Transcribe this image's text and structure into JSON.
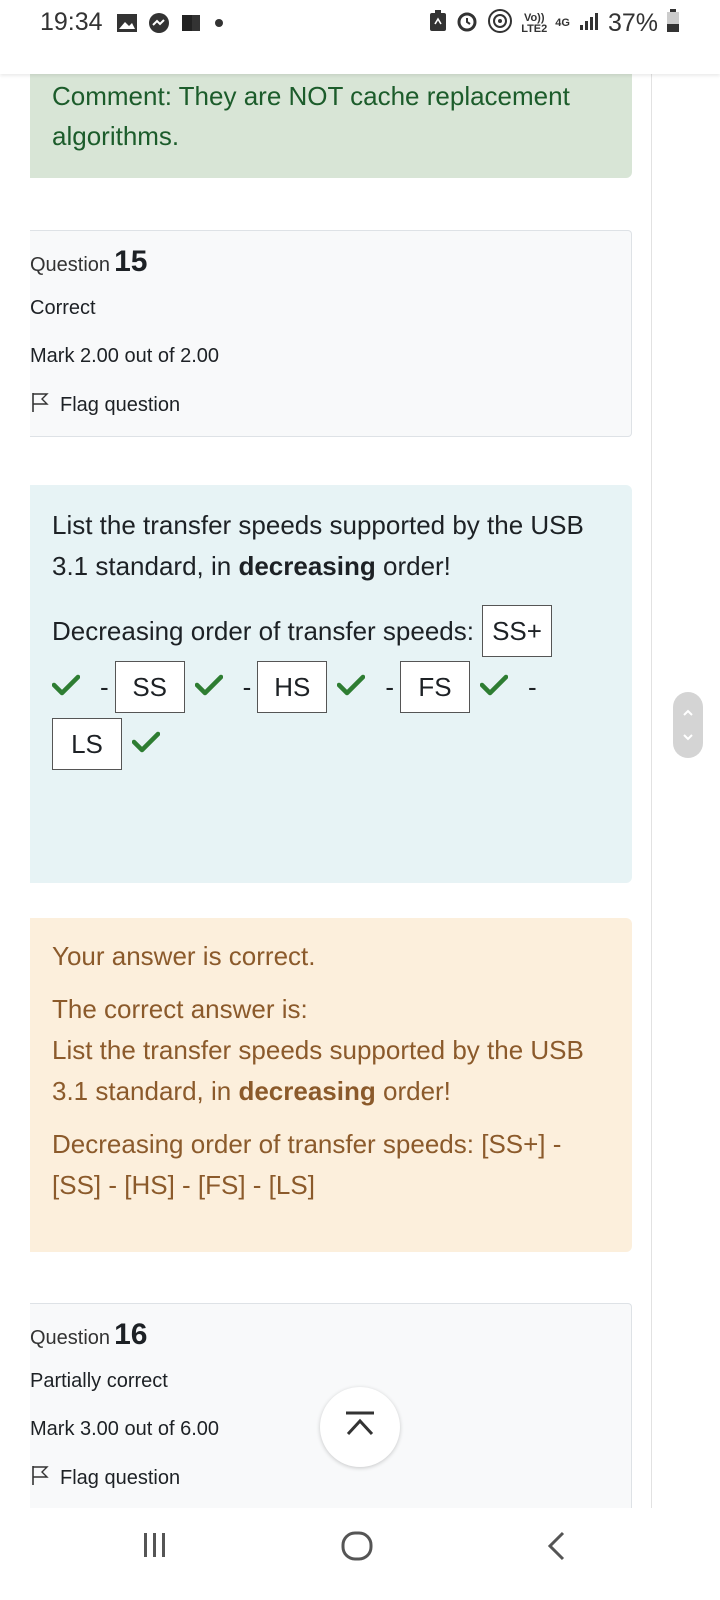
{
  "status_bar": {
    "time": "19:34",
    "battery_percent": "37%",
    "network_top": "Vo))",
    "network_bottom": "LTE2",
    "network_type": "4G",
    "icons": [
      "gallery-icon",
      "messenger-icon",
      "flipboard-icon",
      "dot-icon",
      "battery-saver-icon",
      "alarm-icon",
      "hotspot-icon",
      "signal-icon",
      "battery-icon"
    ]
  },
  "prev_comment": {
    "text": "Comment: They are NOT cache replacement algorithms."
  },
  "question15": {
    "label": "Question",
    "number": "15",
    "state": "Correct",
    "mark": "Mark 2.00 out of 2.00",
    "flag": "Flag question"
  },
  "formulation": {
    "prompt_pre": "List the transfer speeds supported by the USB 3.1 standard, in ",
    "prompt_bold": "decreasing",
    "prompt_post": " order!",
    "answer_label": "Decreasing order of transfer speeds:",
    "separator": "-",
    "answers": [
      "SS+",
      "SS",
      "HS",
      "FS",
      "LS"
    ],
    "answer_status": [
      "correct",
      "correct",
      "correct",
      "correct",
      "correct"
    ]
  },
  "feedback": {
    "result": "Your answer is correct.",
    "correct_intro": "The correct answer is:",
    "prompt_pre": "List the transfer speeds supported by the USB 3.1 standard, in ",
    "prompt_bold": "decreasing",
    "prompt_post": " order!",
    "answer_line": "Decreasing order of transfer speeds: [SS+] - [SS] - [HS] - [FS] - [LS]"
  },
  "question16": {
    "label": "Question",
    "number": "16",
    "state": "Partially correct",
    "mark": "Mark 3.00 out of 6.00",
    "flag": "Flag question"
  },
  "colors": {
    "correct_green": "#2e7d32",
    "comment_bg": "#d8e5d6",
    "formulation_bg": "#e7f3f5",
    "feedback_bg": "#fcefdc",
    "feedback_text": "#8b5a2b"
  },
  "nav": {
    "icons": [
      "recent-apps-icon",
      "home-icon",
      "back-icon"
    ]
  }
}
